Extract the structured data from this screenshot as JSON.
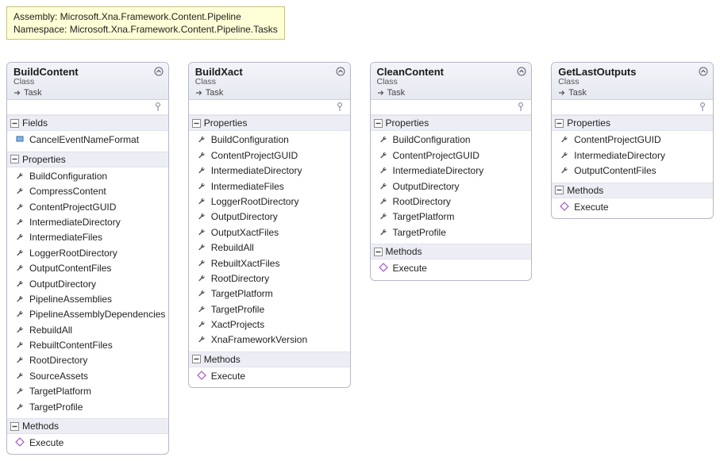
{
  "info": {
    "assembly": "Assembly: Microsoft.Xna.Framework.Content.Pipeline",
    "namespace": "Namespace: Microsoft.Xna.Framework.Content.Pipeline.Tasks"
  },
  "labels": {
    "class": "Class",
    "base_prefix": "Task",
    "fields": "Fields",
    "properties": "Properties",
    "methods": "Methods"
  },
  "classes": [
    {
      "name": "BuildContent",
      "sections": [
        {
          "kind": "fields",
          "members": [
            {
              "t": "field",
              "n": "CancelEventNameFormat"
            }
          ]
        },
        {
          "kind": "properties",
          "members": [
            {
              "t": "prop",
              "n": "BuildConfiguration"
            },
            {
              "t": "prop",
              "n": "CompressContent"
            },
            {
              "t": "prop",
              "n": "ContentProjectGUID"
            },
            {
              "t": "prop",
              "n": "IntermediateDirectory"
            },
            {
              "t": "prop",
              "n": "IntermediateFiles"
            },
            {
              "t": "prop",
              "n": "LoggerRootDirectory"
            },
            {
              "t": "prop",
              "n": "OutputContentFiles"
            },
            {
              "t": "prop",
              "n": "OutputDirectory"
            },
            {
              "t": "prop",
              "n": "PipelineAssemblies"
            },
            {
              "t": "prop",
              "n": "PipelineAssemblyDependencies"
            },
            {
              "t": "prop",
              "n": "RebuildAll"
            },
            {
              "t": "prop",
              "n": "RebuiltContentFiles"
            },
            {
              "t": "prop",
              "n": "RootDirectory"
            },
            {
              "t": "prop",
              "n": "SourceAssets"
            },
            {
              "t": "prop",
              "n": "TargetPlatform"
            },
            {
              "t": "prop",
              "n": "TargetProfile"
            }
          ]
        },
        {
          "kind": "methods",
          "members": [
            {
              "t": "method",
              "n": "Execute"
            }
          ]
        }
      ]
    },
    {
      "name": "BuildXact",
      "sections": [
        {
          "kind": "properties",
          "members": [
            {
              "t": "prop",
              "n": "BuildConfiguration"
            },
            {
              "t": "prop",
              "n": "ContentProjectGUID"
            },
            {
              "t": "prop",
              "n": "IntermediateDirectory"
            },
            {
              "t": "prop",
              "n": "IntermediateFiles"
            },
            {
              "t": "prop",
              "n": "LoggerRootDirectory"
            },
            {
              "t": "prop",
              "n": "OutputDirectory"
            },
            {
              "t": "prop",
              "n": "OutputXactFiles"
            },
            {
              "t": "prop",
              "n": "RebuildAll"
            },
            {
              "t": "prop",
              "n": "RebuiltXactFiles"
            },
            {
              "t": "prop",
              "n": "RootDirectory"
            },
            {
              "t": "prop",
              "n": "TargetPlatform"
            },
            {
              "t": "prop",
              "n": "TargetProfile"
            },
            {
              "t": "prop",
              "n": "XactProjects"
            },
            {
              "t": "prop",
              "n": "XnaFrameworkVersion"
            }
          ]
        },
        {
          "kind": "methods",
          "members": [
            {
              "t": "method",
              "n": "Execute"
            }
          ]
        }
      ]
    },
    {
      "name": "CleanContent",
      "sections": [
        {
          "kind": "properties",
          "members": [
            {
              "t": "prop",
              "n": "BuildConfiguration"
            },
            {
              "t": "prop",
              "n": "ContentProjectGUID"
            },
            {
              "t": "prop",
              "n": "IntermediateDirectory"
            },
            {
              "t": "prop",
              "n": "OutputDirectory"
            },
            {
              "t": "prop",
              "n": "RootDirectory"
            },
            {
              "t": "prop",
              "n": "TargetPlatform"
            },
            {
              "t": "prop",
              "n": "TargetProfile"
            }
          ]
        },
        {
          "kind": "methods",
          "members": [
            {
              "t": "method",
              "n": "Execute"
            }
          ]
        }
      ]
    },
    {
      "name": "GetLastOutputs",
      "sections": [
        {
          "kind": "properties",
          "members": [
            {
              "t": "prop",
              "n": "ContentProjectGUID"
            },
            {
              "t": "prop",
              "n": "IntermediateDirectory"
            },
            {
              "t": "prop",
              "n": "OutputContentFiles"
            }
          ]
        },
        {
          "kind": "methods",
          "members": [
            {
              "t": "method",
              "n": "Execute"
            }
          ]
        }
      ]
    }
  ]
}
